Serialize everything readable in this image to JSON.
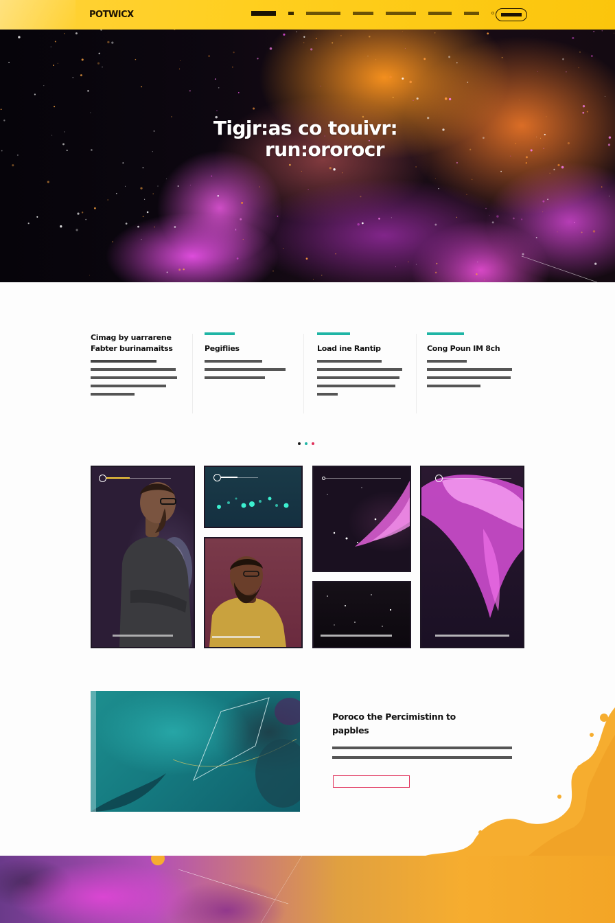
{
  "brand": {
    "logo": "POTWICX"
  },
  "nav": {
    "links": [
      "",
      "",
      "",
      "",
      "",
      ""
    ],
    "dot": "o",
    "cta": ""
  },
  "hero": {
    "title_line1": "Tigjr:as co touivr:",
    "title_line2": "run:ororocr"
  },
  "features": [
    {
      "tag": "",
      "title": "Cimag by uarrarene Fabter burinamaitss",
      "body": ""
    },
    {
      "tag": "",
      "title": "Pegiflies",
      "body": ""
    },
    {
      "tag": "",
      "title": "Load ine Rantip",
      "body": ""
    },
    {
      "tag": "",
      "title": "Cong Poun IM 8ch",
      "body": ""
    }
  ],
  "pager": {
    "count": 3,
    "colors": [
      "#1a1a1a",
      "#1fb5a5",
      "#e0305a"
    ]
  },
  "gallery": {
    "slider_colors": {
      "knob": "#ffffff",
      "fill_yellow": "#ffd23a",
      "fill_white": "#ffffff"
    },
    "cards": [
      {
        "id": "man-glasses",
        "label": ""
      },
      {
        "id": "teal-lights",
        "label": ""
      },
      {
        "id": "man-beard",
        "label": ""
      },
      {
        "id": "pink-galaxy",
        "label": ""
      },
      {
        "id": "starfield",
        "label": ""
      },
      {
        "id": "pink-cloud",
        "label": ""
      }
    ]
  },
  "promo": {
    "title": "Poroco the Percimistinn to papbles",
    "body": "",
    "button_label": ""
  },
  "colors": {
    "accent_yellow": "#ffd23a",
    "accent_teal": "#1fb5a5",
    "accent_pink": "#e0305a",
    "accent_magenta": "#e850e6",
    "accent_orange": "#f6ad2f",
    "dark": "#1e1625"
  }
}
